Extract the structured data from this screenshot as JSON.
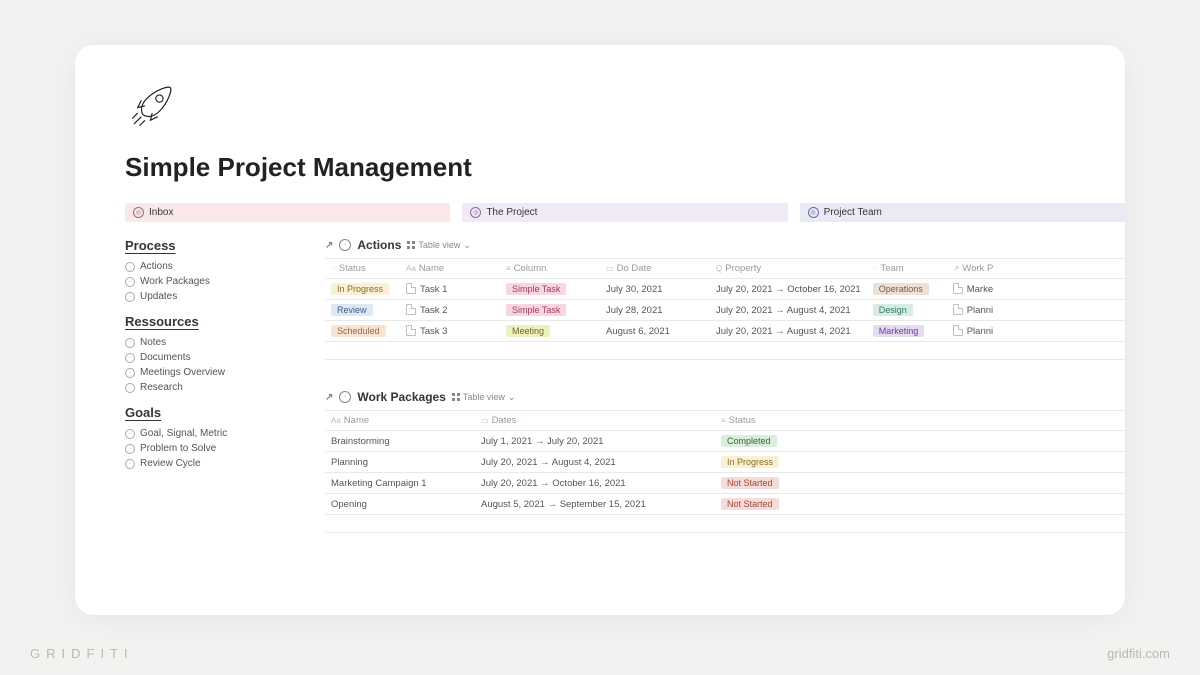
{
  "watermark": {
    "left": "GRIDFITI",
    "right": "gridfiti.com"
  },
  "page": {
    "title": "Simple Project Management"
  },
  "tabs": [
    {
      "label": "Inbox",
      "color": "pink"
    },
    {
      "label": "The Project",
      "color": "purple"
    },
    {
      "label": "Project Team",
      "color": "violet"
    }
  ],
  "sidebar": {
    "groups": [
      {
        "heading": "Process",
        "items": [
          "Actions",
          "Work Packages",
          "Updates"
        ]
      },
      {
        "heading": "Ressources",
        "items": [
          "Notes",
          "Documents",
          "Meetings Overview",
          "Research"
        ]
      },
      {
        "heading": "Goals",
        "items": [
          "Goal, Signal, Metric",
          "Problem to Solve",
          "Review Cycle"
        ]
      }
    ]
  },
  "actions_db": {
    "title": "Actions",
    "view_label": "Table view",
    "columns": [
      "Status",
      "Name",
      "Column",
      "Do Date",
      "Property",
      "Team",
      "Work P"
    ],
    "rows": [
      {
        "status": "In Progress",
        "status_c": "yellow",
        "name": "Task 1",
        "col": "Simple Task",
        "col_c": "pink",
        "do": "July 30, 2021",
        "prop": "July 20, 2021 → October 16, 2021",
        "team": "Operations",
        "team_c": "brown",
        "wp": "Marke"
      },
      {
        "status": "Review",
        "status_c": "blue",
        "name": "Task 2",
        "col": "Simple Task",
        "col_c": "pink",
        "do": "July 28, 2021",
        "prop": "July 20, 2021 → August 4, 2021",
        "team": "Design",
        "team_c": "teal",
        "wp": "Planni"
      },
      {
        "status": "Scheduled",
        "status_c": "orange",
        "name": "Task 3",
        "col": "Meeting",
        "col_c": "lime",
        "do": "August 6, 2021",
        "prop": "July 20, 2021 → August 4, 2021",
        "team": "Marketing",
        "team_c": "purple",
        "wp": "Planni"
      }
    ]
  },
  "workpkg_db": {
    "title": "Work Packages",
    "view_label": "Table view",
    "columns": [
      "Name",
      "Dates",
      "Status"
    ],
    "rows": [
      {
        "name": "Brainstorming",
        "dates": "July 1, 2021 → July 20, 2021",
        "status": "Completed",
        "status_c": "green"
      },
      {
        "name": "Planning",
        "dates": "July 20, 2021 → August 4, 2021",
        "status": "In Progress",
        "status_c": "yellow"
      },
      {
        "name": "Marketing Campaign 1",
        "dates": "July 20, 2021 → October 16, 2021",
        "status": "Not Started",
        "status_c": "red"
      },
      {
        "name": "Opening",
        "dates": "August 5, 2021 → September 15, 2021",
        "status": "Not Started",
        "status_c": "red"
      }
    ]
  }
}
